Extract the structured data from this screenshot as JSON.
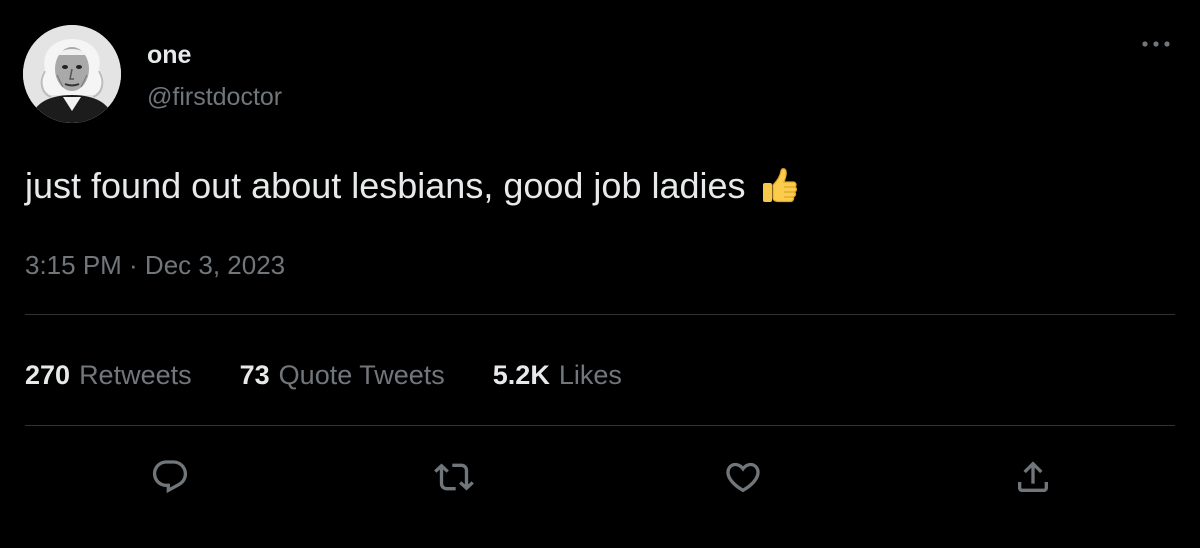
{
  "author": {
    "display_name": "one",
    "handle": "@firstdoctor",
    "avatar_icon": "portrait-avatar"
  },
  "tweet": {
    "text": "just found out about lesbians, good job ladies",
    "emoji": "thumbs-up-icon",
    "timestamp": "3:15 PM · Dec 3, 2023"
  },
  "stats": [
    {
      "count": "270",
      "label": "Retweets"
    },
    {
      "count": "73",
      "label": "Quote Tweets"
    },
    {
      "count": "5.2K",
      "label": "Likes"
    }
  ],
  "actions": {
    "reply_icon": "reply-icon",
    "retweet_icon": "retweet-icon",
    "like_icon": "heart-icon",
    "share_icon": "share-icon",
    "more_icon": "more-options-icon"
  },
  "colors": {
    "background": "#000000",
    "primary_text": "#e7e9ea",
    "secondary_text": "#71767b",
    "divider": "#2f3336"
  }
}
